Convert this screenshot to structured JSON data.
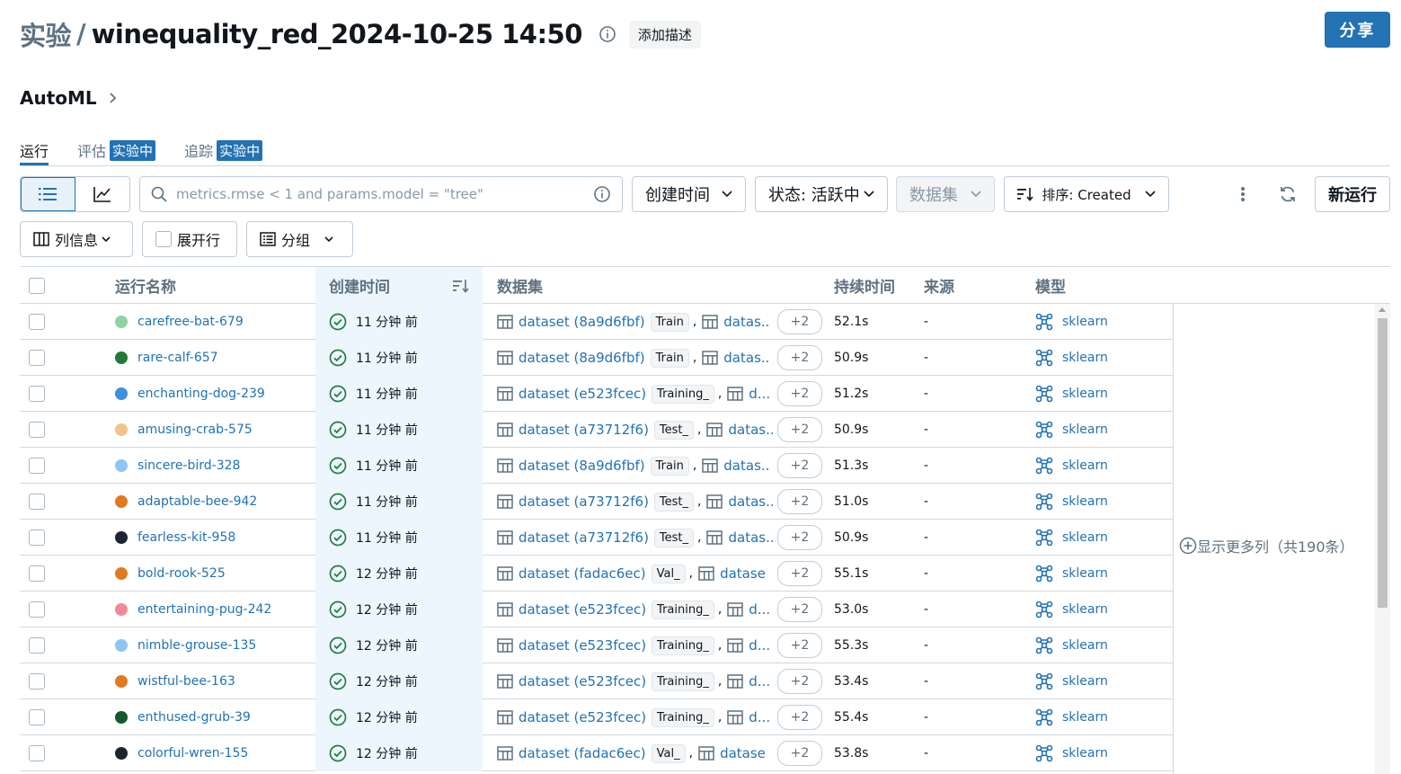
{
  "header": {
    "title_prefix": "实验",
    "title_separator": "/",
    "experiment_name": "winequality_red_2024-10-25 14:50",
    "add_description": "添加描述",
    "share_label": "分享"
  },
  "breadcrumb": {
    "label": "AutoML"
  },
  "tabs": [
    {
      "label": "运行",
      "badge": ""
    },
    {
      "label": "评估",
      "badge": "实验中"
    },
    {
      "label": "追踪",
      "badge": "实验中"
    }
  ],
  "toolbar": {
    "search_placeholder": "metrics.rmse < 1 and params.model = \"tree\"",
    "created_filter": "创建时间",
    "state_filter": "状态: 活跃中",
    "datasets_filter": "数据集",
    "sort_label": "排序: Created",
    "new_run": "新运行"
  },
  "toolbar2": {
    "columns": "列信息",
    "expand_rows": "展开行",
    "group": "分组"
  },
  "table": {
    "headers": {
      "name": "运行名称",
      "created": "创建时间",
      "dataset": "数据集",
      "duration": "持续时间",
      "source": "来源",
      "model": "模型"
    },
    "show_more": "显示更多列（共190条）",
    "rows": [
      {
        "name": "carefree-bat-679",
        "color": "#8fd3a0",
        "created": "11 分钟 前",
        "dataset": "dataset (8a9d6fbf)",
        "tag": "Train",
        "second": "datas...",
        "more": "+2",
        "duration": "52.1s",
        "source": "-",
        "model": "sklearn"
      },
      {
        "name": "rare-calf-657",
        "color": "#1f7a3a",
        "created": "11 分钟 前",
        "dataset": "dataset (8a9d6fbf)",
        "tag": "Train",
        "second": "datas...",
        "more": "+2",
        "duration": "50.9s",
        "source": "-",
        "model": "sklearn"
      },
      {
        "name": "enchanting-dog-239",
        "color": "#3d8fe0",
        "created": "11 分钟 前",
        "dataset": "dataset (e523fcec)",
        "tag": "Training_",
        "second": "d...",
        "more": "+2",
        "duration": "51.2s",
        "source": "-",
        "model": "sklearn"
      },
      {
        "name": "amusing-crab-575",
        "color": "#f0c48a",
        "created": "11 分钟 前",
        "dataset": "dataset (a73712f6)",
        "tag": "Test_",
        "second": "datas...",
        "more": "+2",
        "duration": "50.9s",
        "source": "-",
        "model": "sklearn"
      },
      {
        "name": "sincere-bird-328",
        "color": "#8ec5f2",
        "created": "11 分钟 前",
        "dataset": "dataset (8a9d6fbf)",
        "tag": "Train",
        "second": "datas...",
        "more": "+2",
        "duration": "51.3s",
        "source": "-",
        "model": "sklearn"
      },
      {
        "name": "adaptable-bee-942",
        "color": "#e07a22",
        "created": "11 分钟 前",
        "dataset": "dataset (a73712f6)",
        "tag": "Test_",
        "second": "datas...",
        "more": "+2",
        "duration": "51.0s",
        "source": "-",
        "model": "sklearn"
      },
      {
        "name": "fearless-kit-958",
        "color": "#1c2530",
        "created": "11 分钟 前",
        "dataset": "dataset (a73712f6)",
        "tag": "Test_",
        "second": "datas...",
        "more": "+2",
        "duration": "50.9s",
        "source": "-",
        "model": "sklearn"
      },
      {
        "name": "bold-rook-525",
        "color": "#e07a22",
        "created": "12 分钟 前",
        "dataset": "dataset (fadac6ec)",
        "tag": "Val_",
        "second": "datase...",
        "more": "+2",
        "duration": "55.1s",
        "source": "-",
        "model": "sklearn"
      },
      {
        "name": "entertaining-pug-242",
        "color": "#f08a9a",
        "created": "12 分钟 前",
        "dataset": "dataset (e523fcec)",
        "tag": "Training_",
        "second": "d...",
        "more": "+2",
        "duration": "53.0s",
        "source": "-",
        "model": "sklearn"
      },
      {
        "name": "nimble-grouse-135",
        "color": "#8ec5f2",
        "created": "12 分钟 前",
        "dataset": "dataset (e523fcec)",
        "tag": "Training_",
        "second": "d...",
        "more": "+2",
        "duration": "55.3s",
        "source": "-",
        "model": "sklearn"
      },
      {
        "name": "wistful-bee-163",
        "color": "#e07a22",
        "created": "12 分钟 前",
        "dataset": "dataset (e523fcec)",
        "tag": "Training_",
        "second": "d...",
        "more": "+2",
        "duration": "53.4s",
        "source": "-",
        "model": "sklearn"
      },
      {
        "name": "enthused-grub-39",
        "color": "#145a2e",
        "created": "12 分钟 前",
        "dataset": "dataset (e523fcec)",
        "tag": "Training_",
        "second": "d...",
        "more": "+2",
        "duration": "55.4s",
        "source": "-",
        "model": "sklearn"
      },
      {
        "name": "colorful-wren-155",
        "color": "#1c2530",
        "created": "12 分钟 前",
        "dataset": "dataset (fadac6ec)",
        "tag": "Val_",
        "second": "datase...",
        "more": "+2",
        "duration": "53.8s",
        "source": "-",
        "model": "sklearn"
      }
    ]
  }
}
